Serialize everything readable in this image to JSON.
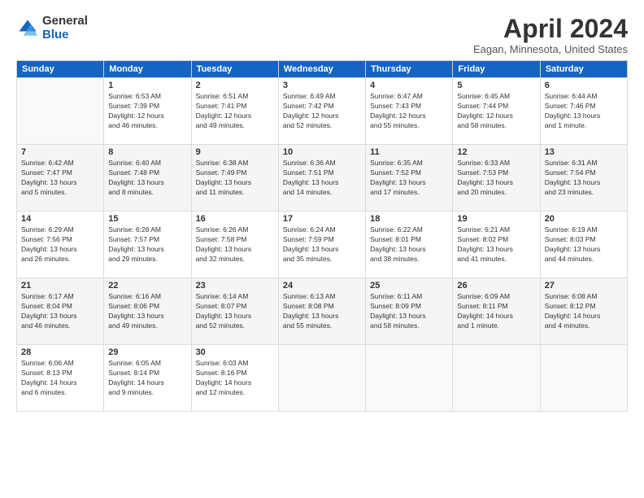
{
  "logo": {
    "general": "General",
    "blue": "Blue"
  },
  "title": "April 2024",
  "location": "Eagan, Minnesota, United States",
  "weekdays": [
    "Sunday",
    "Monday",
    "Tuesday",
    "Wednesday",
    "Thursday",
    "Friday",
    "Saturday"
  ],
  "weeks": [
    [
      {
        "day": "",
        "info": ""
      },
      {
        "day": "1",
        "info": "Sunrise: 6:53 AM\nSunset: 7:39 PM\nDaylight: 12 hours\nand 46 minutes."
      },
      {
        "day": "2",
        "info": "Sunrise: 6:51 AM\nSunset: 7:41 PM\nDaylight: 12 hours\nand 49 minutes."
      },
      {
        "day": "3",
        "info": "Sunrise: 6:49 AM\nSunset: 7:42 PM\nDaylight: 12 hours\nand 52 minutes."
      },
      {
        "day": "4",
        "info": "Sunrise: 6:47 AM\nSunset: 7:43 PM\nDaylight: 12 hours\nand 55 minutes."
      },
      {
        "day": "5",
        "info": "Sunrise: 6:45 AM\nSunset: 7:44 PM\nDaylight: 12 hours\nand 58 minutes."
      },
      {
        "day": "6",
        "info": "Sunrise: 6:44 AM\nSunset: 7:46 PM\nDaylight: 13 hours\nand 1 minute."
      }
    ],
    [
      {
        "day": "7",
        "info": "Sunrise: 6:42 AM\nSunset: 7:47 PM\nDaylight: 13 hours\nand 5 minutes."
      },
      {
        "day": "8",
        "info": "Sunrise: 6:40 AM\nSunset: 7:48 PM\nDaylight: 13 hours\nand 8 minutes."
      },
      {
        "day": "9",
        "info": "Sunrise: 6:38 AM\nSunset: 7:49 PM\nDaylight: 13 hours\nand 11 minutes."
      },
      {
        "day": "10",
        "info": "Sunrise: 6:36 AM\nSunset: 7:51 PM\nDaylight: 13 hours\nand 14 minutes."
      },
      {
        "day": "11",
        "info": "Sunrise: 6:35 AM\nSunset: 7:52 PM\nDaylight: 13 hours\nand 17 minutes."
      },
      {
        "day": "12",
        "info": "Sunrise: 6:33 AM\nSunset: 7:53 PM\nDaylight: 13 hours\nand 20 minutes."
      },
      {
        "day": "13",
        "info": "Sunrise: 6:31 AM\nSunset: 7:54 PM\nDaylight: 13 hours\nand 23 minutes."
      }
    ],
    [
      {
        "day": "14",
        "info": "Sunrise: 6:29 AM\nSunset: 7:56 PM\nDaylight: 13 hours\nand 26 minutes."
      },
      {
        "day": "15",
        "info": "Sunrise: 6:28 AM\nSunset: 7:57 PM\nDaylight: 13 hours\nand 29 minutes."
      },
      {
        "day": "16",
        "info": "Sunrise: 6:26 AM\nSunset: 7:58 PM\nDaylight: 13 hours\nand 32 minutes."
      },
      {
        "day": "17",
        "info": "Sunrise: 6:24 AM\nSunset: 7:59 PM\nDaylight: 13 hours\nand 35 minutes."
      },
      {
        "day": "18",
        "info": "Sunrise: 6:22 AM\nSunset: 8:01 PM\nDaylight: 13 hours\nand 38 minutes."
      },
      {
        "day": "19",
        "info": "Sunrise: 6:21 AM\nSunset: 8:02 PM\nDaylight: 13 hours\nand 41 minutes."
      },
      {
        "day": "20",
        "info": "Sunrise: 6:19 AM\nSunset: 8:03 PM\nDaylight: 13 hours\nand 44 minutes."
      }
    ],
    [
      {
        "day": "21",
        "info": "Sunrise: 6:17 AM\nSunset: 8:04 PM\nDaylight: 13 hours\nand 46 minutes."
      },
      {
        "day": "22",
        "info": "Sunrise: 6:16 AM\nSunset: 8:06 PM\nDaylight: 13 hours\nand 49 minutes."
      },
      {
        "day": "23",
        "info": "Sunrise: 6:14 AM\nSunset: 8:07 PM\nDaylight: 13 hours\nand 52 minutes."
      },
      {
        "day": "24",
        "info": "Sunrise: 6:13 AM\nSunset: 8:08 PM\nDaylight: 13 hours\nand 55 minutes."
      },
      {
        "day": "25",
        "info": "Sunrise: 6:11 AM\nSunset: 8:09 PM\nDaylight: 13 hours\nand 58 minutes."
      },
      {
        "day": "26",
        "info": "Sunrise: 6:09 AM\nSunset: 8:11 PM\nDaylight: 14 hours\nand 1 minute."
      },
      {
        "day": "27",
        "info": "Sunrise: 6:08 AM\nSunset: 8:12 PM\nDaylight: 14 hours\nand 4 minutes."
      }
    ],
    [
      {
        "day": "28",
        "info": "Sunrise: 6:06 AM\nSunset: 8:13 PM\nDaylight: 14 hours\nand 6 minutes."
      },
      {
        "day": "29",
        "info": "Sunrise: 6:05 AM\nSunset: 8:14 PM\nDaylight: 14 hours\nand 9 minutes."
      },
      {
        "day": "30",
        "info": "Sunrise: 6:03 AM\nSunset: 8:16 PM\nDaylight: 14 hours\nand 12 minutes."
      },
      {
        "day": "",
        "info": ""
      },
      {
        "day": "",
        "info": ""
      },
      {
        "day": "",
        "info": ""
      },
      {
        "day": "",
        "info": ""
      }
    ]
  ]
}
